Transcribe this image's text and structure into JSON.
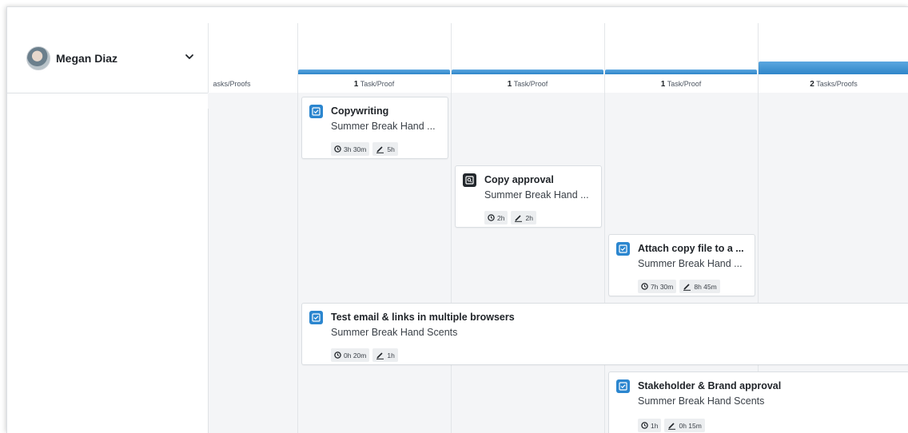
{
  "user": {
    "name": "Megan Diaz"
  },
  "columns": [
    {
      "label_num": "",
      "label_text": "asks/Proofs"
    },
    {
      "label_num": "1",
      "label_text": "Task/Proof"
    },
    {
      "label_num": "1",
      "label_text": "Task/Proof"
    },
    {
      "label_num": "1",
      "label_text": "Task/Proof"
    },
    {
      "label_num": "2",
      "label_text": "Tasks/Proofs"
    }
  ],
  "cards": [
    {
      "type": "task",
      "title": "Copywriting",
      "subtitle": "Summer Break Hand ...",
      "time": "3h 30m",
      "effort": "5h"
    },
    {
      "type": "proof",
      "title": "Copy approval",
      "subtitle": "Summer Break Hand ...",
      "time": "2h",
      "effort": "2h"
    },
    {
      "type": "task",
      "title": "Attach copy file to a ...",
      "subtitle": "Summer Break Hand ...",
      "time": "7h 30m",
      "effort": "8h 45m"
    },
    {
      "type": "task",
      "title": "Test email & links in multiple browsers",
      "subtitle": "Summer Break Hand Scents",
      "time": "0h 20m",
      "effort": "1h"
    },
    {
      "type": "task",
      "title": "Stakeholder & Brand approval",
      "subtitle": "Summer Break Hand Scents",
      "time": "1h",
      "effort": "0h 15m"
    }
  ],
  "icons": {
    "task": "checkbox-task-icon",
    "proof": "proof-icon",
    "time": "clock-icon",
    "effort": "pencil-icon",
    "dropdown": "chevron-down-icon"
  },
  "colors": {
    "accent": "#2b86cf",
    "bar": "#3b8fd0",
    "proof_icon_bg": "#23282d",
    "grid_bg": "#f4f5f7"
  }
}
